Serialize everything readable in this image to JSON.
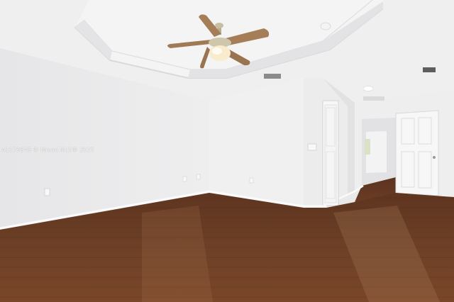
{
  "image": {
    "description_type": "real-estate interior photo",
    "watermark": "A1179648 © Miami MLS® 2025"
  },
  "colors": {
    "ceiling": "#eeeeef",
    "wall_left": "#eaeaeb",
    "wall_back": "#f1f1f2",
    "wall_right": "#ededee",
    "floor": "#6e3f24",
    "floor_dark": "#5a301a",
    "fan_blade": "#a07a55",
    "fan_light": "#f6e9c8",
    "door": "#f7f7f7"
  }
}
